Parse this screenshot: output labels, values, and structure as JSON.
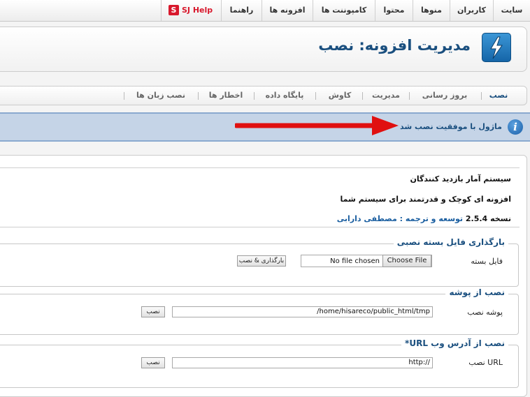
{
  "topmenu": {
    "items": [
      "سایت",
      "کاربران",
      "منوها",
      "محتوا",
      "کامپوننت ها",
      "افزونه ها",
      "راهنما"
    ],
    "help": {
      "icon": "S",
      "label": "SJ Help"
    }
  },
  "header": {
    "title": "مدیریت افزونه: نصب",
    "icon": "lightning-bolt-icon"
  },
  "submenu": {
    "tabs": [
      "نصب",
      "بروز رسانی",
      "مدیریت",
      "کاوش",
      "پایگاه داده",
      "اخطار ها",
      "نصب زبان ها"
    ]
  },
  "message": {
    "text": "ماژول با موفقیت نصب شد",
    "icon": "i"
  },
  "extension_info": {
    "name": "سیستم آمار بازدید کنندگان",
    "description": "افزونه ای کوچک و قدرتمند برای سیستم شما",
    "version_prefix": "نسخه",
    "version": "2.5.4",
    "credit": "توسعه و ترجمه : مصطفی دارابی"
  },
  "upload_section": {
    "legend": "بارگذاری فایل بسته نصبی",
    "label": "فایل بسته",
    "file_status": "No file chosen",
    "choose_button": "Choose File",
    "submit_button": "بارگذاری & نصب"
  },
  "folder_section": {
    "legend": "نصب از پوشه",
    "label": "پوشه نصب",
    "value": "/home/hisareco/public_html/tmp",
    "submit_button": "نصب"
  },
  "url_section": {
    "legend": "نصب از آدرس وب URL*",
    "label": "URL نصب",
    "value": "http://",
    "submit_button": "نصب"
  },
  "colors": {
    "accent": "#1a4f7f",
    "help_red": "#d8182c",
    "message_bg": "#c5d4e7",
    "arrow": "#e01010"
  }
}
